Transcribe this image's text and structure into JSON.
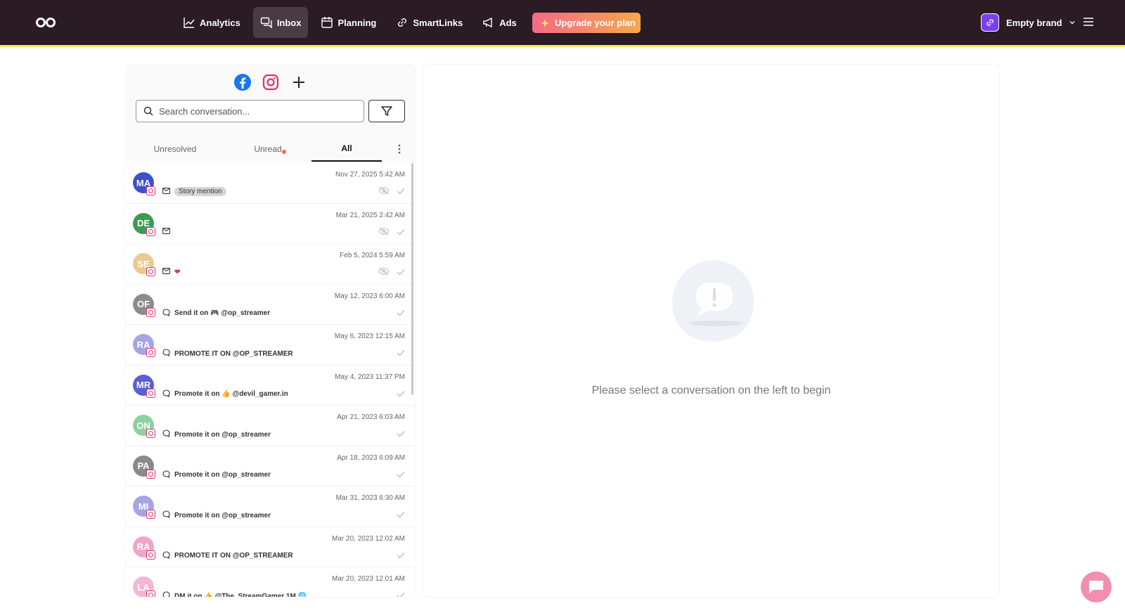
{
  "nav": {
    "items": [
      {
        "label": "Analytics",
        "icon": "chart-line-icon",
        "active": false
      },
      {
        "label": "Inbox",
        "icon": "chat-bubbles-icon",
        "active": true
      },
      {
        "label": "Planning",
        "icon": "calendar-icon",
        "active": false
      },
      {
        "label": "SmartLinks",
        "icon": "link-icon",
        "active": false
      },
      {
        "label": "Ads",
        "icon": "megaphone-icon",
        "active": false
      }
    ],
    "upgrade_label": "Upgrade your plan",
    "brand_name": "Empty brand"
  },
  "inbox": {
    "search_placeholder": "Search conversation...",
    "tabs": [
      {
        "label": "Unresolved",
        "active": false,
        "dot": false
      },
      {
        "label": "Unread",
        "active": false,
        "dot": true
      },
      {
        "label": "All",
        "active": true,
        "dot": false
      }
    ],
    "conversations": [
      {
        "initials": "MA",
        "name": "",
        "date": "Nov 27, 2025 5:42 AM",
        "type": "mail",
        "preview": "",
        "pill": "Story mention",
        "hidden": true,
        "color": "#3f51c9"
      },
      {
        "initials": "DE",
        "name": "",
        "date": "Mar 21, 2025 2:42 AM",
        "type": "mail",
        "preview": "",
        "pill": "",
        "hidden": true,
        "color": "#3f9a55"
      },
      {
        "initials": "SE",
        "name": "",
        "date": "Feb 5, 2024 5:59 AM",
        "type": "mail",
        "preview": "",
        "pill": "",
        "hidden": true,
        "emoji": "❤",
        "color": "#ebc98f"
      },
      {
        "initials": "OF",
        "name": "",
        "date": "May 12, 2023 6:00 AM",
        "type": "comment",
        "preview": "Send it on 🎮 @op_streamer",
        "pill": "",
        "hidden": false,
        "color": "#8c8c8c"
      },
      {
        "initials": "RA",
        "name": "",
        "date": "May 6, 2023 12:15 AM",
        "type": "comment",
        "preview": "PROMOTE IT ON @OP_STREAMER",
        "pill": "",
        "hidden": false,
        "color": "#a7a4e6"
      },
      {
        "initials": "MR",
        "name": "",
        "date": "May 4, 2023 11:37 PM",
        "type": "comment",
        "preview": "Promote it on 👍 @devil_gamer.in",
        "pill": "",
        "hidden": false,
        "color": "#5b5fd6"
      },
      {
        "initials": "ON",
        "name": "",
        "date": "Apr 21, 2023 6:03 AM",
        "type": "comment",
        "preview": "Promote it on @op_streamer",
        "pill": "",
        "hidden": false,
        "color": "#8ed19f"
      },
      {
        "initials": "PA",
        "name": "",
        "date": "Apr 18, 2023 6:09 AM",
        "type": "comment",
        "preview": "Promote it on @op_streamer",
        "pill": "",
        "hidden": false,
        "color": "#8a8a8a"
      },
      {
        "initials": "MI",
        "name": "",
        "date": "Mar 31, 2023 6:30 AM",
        "type": "comment",
        "preview": "Promote it on @op_streamer",
        "pill": "",
        "hidden": false,
        "color": "#a7a4e6"
      },
      {
        "initials": "RA",
        "name": "",
        "date": "Mar 20, 2023 12:02 AM",
        "type": "comment",
        "preview": "PROMOTE IT ON @OP_STREAMER",
        "pill": "",
        "hidden": false,
        "color": "#f0a6c8"
      },
      {
        "initials": "LA",
        "name": "",
        "date": "Mar 20, 2023 12:01 AM",
        "type": "comment",
        "preview": "DM it on 👍 @The_StreamGamer 1M 🌐",
        "pill": "",
        "hidden": false,
        "color": "#f3b6d6"
      }
    ]
  },
  "empty_state": {
    "message": "Please select a conversation on the left to begin"
  }
}
